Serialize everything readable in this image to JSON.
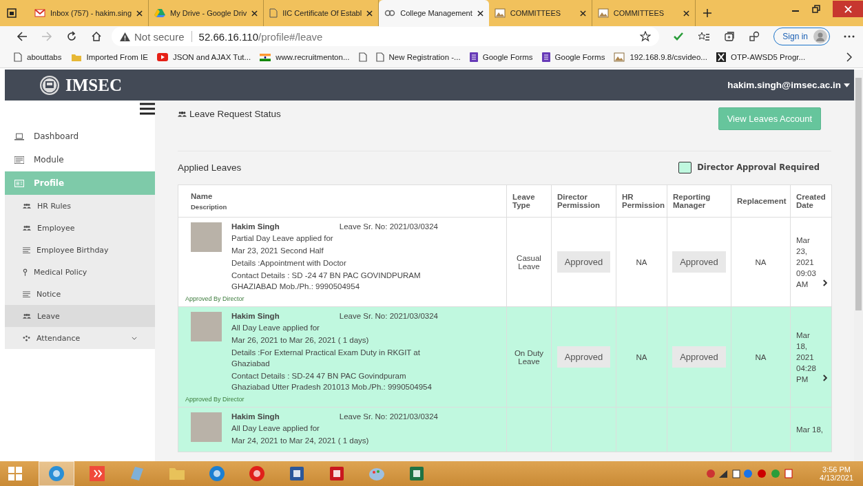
{
  "browser": {
    "tabs": [
      {
        "kind": "mail",
        "title": "Inbox (757) - hakim.sing",
        "selected": false
      },
      {
        "kind": "drive",
        "title": "My Drive - Google Driv",
        "selected": false
      },
      {
        "kind": "page",
        "title": "IIC Certificate Of Establ",
        "selected": false
      },
      {
        "kind": "link",
        "title": "College Management",
        "selected": true
      },
      {
        "kind": "image",
        "title": "COMMITTEES",
        "selected": false
      },
      {
        "kind": "image",
        "title": "COMMITTEES",
        "selected": false
      }
    ],
    "security": "Not secure",
    "url_host": "52.66.16.110",
    "url_path": "/profile#/leave",
    "sign_in": "Sign in",
    "bookmarks": [
      {
        "kind": "page",
        "label": "abouttabs"
      },
      {
        "kind": "folder",
        "label": "Imported From IE"
      },
      {
        "kind": "video",
        "label": "JSON and AJAX Tut..."
      },
      {
        "kind": "flag",
        "label": "www.recruitmenton..."
      },
      {
        "kind": "page"
      },
      {
        "kind": "page",
        "label": "New Registration -..."
      },
      {
        "kind": "forms",
        "label": "Google Forms"
      },
      {
        "kind": "forms",
        "label": "Google Forms"
      },
      {
        "kind": "image",
        "label": "192.168.9.8/csvideo..."
      },
      {
        "kind": "x",
        "label": "OTP-AWSD5 Progr..."
      }
    ]
  },
  "header": {
    "brand": "IMSEC",
    "user": "hakim.singh@imsec.ac.in"
  },
  "sidebar": {
    "items": [
      {
        "kind": "laptop",
        "label": "Dashboard",
        "selected": false
      },
      {
        "kind": "module",
        "label": "Module",
        "selected": false
      },
      {
        "kind": "card",
        "label": "Profile",
        "selected": true,
        "expanded": true,
        "children": [
          {
            "kind": "users",
            "label": "HR Rules",
            "selected": false
          },
          {
            "kind": "users",
            "label": "Employee",
            "selected": false
          },
          {
            "kind": "list",
            "label": "Employee Birthday",
            "selected": false
          },
          {
            "kind": "pin",
            "label": "Medical Policy",
            "selected": false
          },
          {
            "kind": "list",
            "label": "Notice",
            "selected": false
          },
          {
            "kind": "users",
            "label": "Leave",
            "selected": true
          },
          {
            "kind": "dots",
            "label": "Attendance",
            "selected": false,
            "expanded": false
          }
        ]
      }
    ]
  },
  "page_title": "Leave Request Status",
  "view_button": "View Leaves Account",
  "section_title": "Applied Leaves",
  "legend": "Director Approval Required",
  "table": {
    "columns": [
      {
        "label": "Name",
        "sub": "Description"
      },
      {
        "label": "Leave Type"
      },
      {
        "label": "Director Permission"
      },
      {
        "label": "HR Permission"
      },
      {
        "label": "Reporting Manager"
      },
      {
        "label": "Replacement"
      },
      {
        "label": "Created Date"
      }
    ],
    "rows": [
      {
        "director_approval_required": false,
        "name": "Hakim Singh",
        "sr_no": "Leave Sr. No: 2021/03/0324",
        "lines": [
          "Partial Day Leave applied for",
          "Mar 23, 2021 Second Half",
          "Details :Appointment with Doctor",
          "Contact Details : SD -24 47 BN PAC GOVINDPURAM GHAZIABAD Mob./Ph.: 9990504954"
        ],
        "note": "Approved By Director",
        "leave_type": "Casual Leave",
        "director_permission": "Approved",
        "hr_permission": "NA",
        "reporting_manager": "Approved",
        "replacement": "NA",
        "created": "Mar 23, 2021 09:03 AM"
      },
      {
        "director_approval_required": true,
        "name": "Hakim Singh",
        "sr_no": "Leave Sr. No: 2021/03/0324",
        "lines": [
          "All Day Leave applied for",
          "Mar 26, 2021 to Mar 26, 2021 ( 1 days)",
          "Details :For External Practical Exam Duty in RKGIT at Ghaziabad",
          "Contact Details : SD-24 47 BN PAC Govindpuram Ghaziabad Utter Pradesh 201013 Mob./Ph.: 9990504954"
        ],
        "note": "Approved By Director",
        "leave_type": "On Duty Leave",
        "director_permission": "Approved",
        "hr_permission": "NA",
        "reporting_manager": "Approved",
        "replacement": "NA",
        "created": "Mar 18, 2021 04:28 PM"
      },
      {
        "director_approval_required": true,
        "name": "Hakim Singh",
        "sr_no": "Leave Sr. No: 2021/03/0324",
        "lines": [
          "All Day Leave applied for",
          "Mar 24, 2021 to Mar 24, 2021 ( 1 days)"
        ],
        "created": "Mar 18,"
      }
    ]
  },
  "taskbar": {
    "apps": [
      {
        "kind": "edge",
        "selected": true
      },
      {
        "kind": "git",
        "selected": false
      },
      {
        "kind": "book",
        "selected": false
      },
      {
        "kind": "folder",
        "selected": false
      },
      {
        "kind": "ie",
        "selected": false
      },
      {
        "kind": "opera",
        "selected": false
      },
      {
        "kind": "word",
        "selected": false
      },
      {
        "kind": "pdf",
        "selected": false
      },
      {
        "kind": "paint",
        "selected": false
      },
      {
        "kind": "excel",
        "selected": false
      }
    ],
    "time": "3:56 PM",
    "date": "4/13/2021"
  }
}
